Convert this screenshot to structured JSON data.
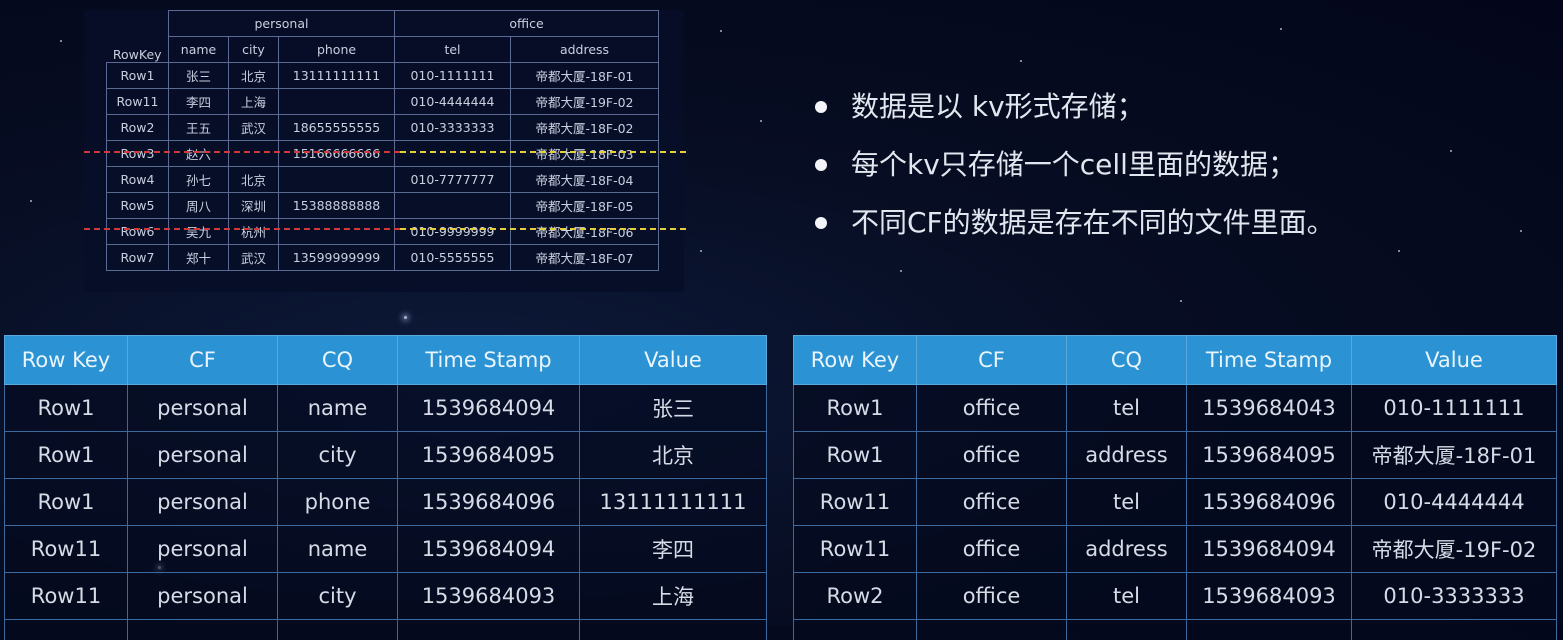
{
  "hbase_table": {
    "rowkey_header": "RowKey",
    "families": [
      {
        "name": "personal",
        "columns": [
          "name",
          "city",
          "phone"
        ]
      },
      {
        "name": "office",
        "columns": [
          "tel",
          "address"
        ]
      }
    ],
    "rows": [
      [
        "Row1",
        "张三",
        "北京",
        "13111111111",
        "010-1111111",
        "帝都大厦-18F-01"
      ],
      [
        "Row11",
        "李四",
        "上海",
        "",
        "010-4444444",
        "帝都大厦-19F-02"
      ],
      [
        "Row2",
        "王五",
        "武汉",
        "18655555555",
        "010-3333333",
        "帝都大厦-18F-02"
      ],
      [
        "Row3",
        "赵六",
        "",
        "15166666666",
        "",
        "帝都大厦-18F-03"
      ],
      [
        "Row4",
        "孙七",
        "北京",
        "",
        "010-7777777",
        "帝都大厦-18F-04"
      ],
      [
        "Row5",
        "周八",
        "深圳",
        "15388888888",
        "",
        "帝都大厦-18F-05"
      ],
      [
        "Row6",
        "吴九",
        "杭州",
        "",
        "010-9999999",
        "帝都大厦-18F-06"
      ],
      [
        "Row7",
        "郑十",
        "武汉",
        "13599999999",
        "010-5555555",
        "帝都大厦-18F-07"
      ]
    ]
  },
  "bullets": [
    "数据是以 kv形式存储；",
    "每个kv只存储一个cell里面的数据；",
    "不同CF的数据是存在不同的文件里面。"
  ],
  "kv_headers": [
    "Row Key",
    "CF",
    "CQ",
    "Time Stamp",
    "Value"
  ],
  "kv_left": [
    [
      "Row1",
      "personal",
      "name",
      "1539684094",
      "张三"
    ],
    [
      "Row1",
      "personal",
      "city",
      "1539684095",
      "北京"
    ],
    [
      "Row1",
      "personal",
      "phone",
      "1539684096",
      "13111111111"
    ],
    [
      "Row11",
      "personal",
      "name",
      "1539684094",
      "李四"
    ],
    [
      "Row11",
      "personal",
      "city",
      "1539684093",
      "上海"
    ]
  ],
  "kv_right": [
    [
      "Row1",
      "office",
      "tel",
      "1539684043",
      "010-1111111"
    ],
    [
      "Row1",
      "office",
      "address",
      "1539684095",
      "帝都大厦-18F-01"
    ],
    [
      "Row11",
      "office",
      "tel",
      "1539684096",
      "010-4444444"
    ],
    [
      "Row11",
      "office",
      "address",
      "1539684094",
      "帝都大厦-19F-02"
    ],
    [
      "Row2",
      "office",
      "tel",
      "1539684093",
      "010-3333333"
    ]
  ]
}
